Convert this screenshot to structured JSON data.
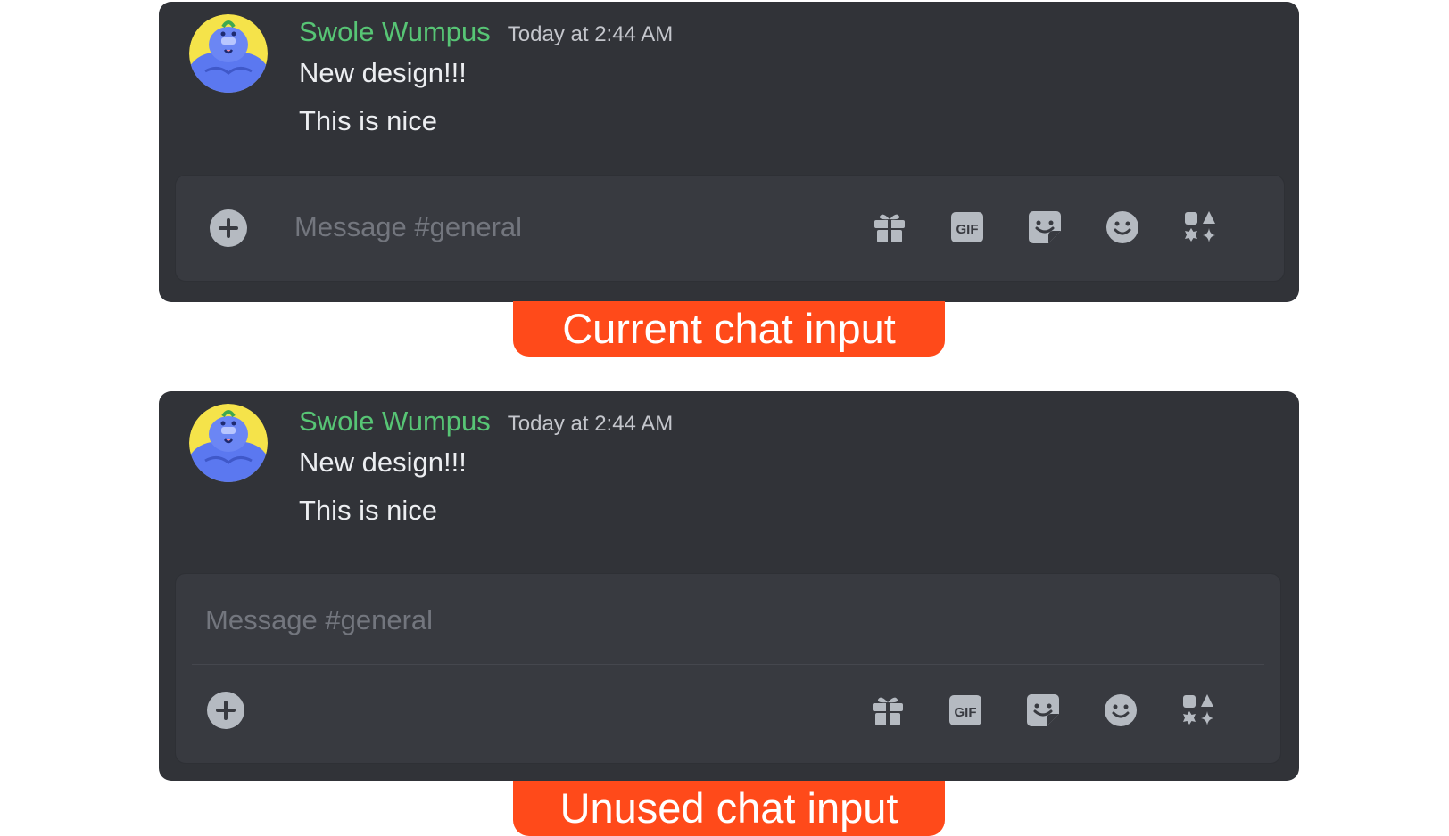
{
  "panels": [
    {
      "message": {
        "username": "Swole Wumpus",
        "timestamp": "Today at 2:44 AM",
        "lines": [
          "New design!!!",
          "This is nice"
        ]
      },
      "input": {
        "placeholder": "Message #general",
        "icons": [
          "gift-icon",
          "gif-icon",
          "sticker-icon",
          "emoji-icon",
          "apps-icon"
        ]
      },
      "caption": "Current chat input"
    },
    {
      "message": {
        "username": "Swole Wumpus",
        "timestamp": "Today at 2:44 AM",
        "lines": [
          "New design!!!",
          "This is nice"
        ]
      },
      "input": {
        "placeholder": "Message #general",
        "icons": [
          "gift-icon",
          "gif-icon",
          "sticker-icon",
          "emoji-icon",
          "apps-icon"
        ]
      },
      "caption": "Unused chat input"
    }
  ],
  "gif_icon_text": "GIF",
  "colors": {
    "panel_bg": "#313338",
    "input_bg": "#383a40",
    "username": "#57c575",
    "caption_bg": "#ff4a1a",
    "icon": "#b5bac1"
  }
}
